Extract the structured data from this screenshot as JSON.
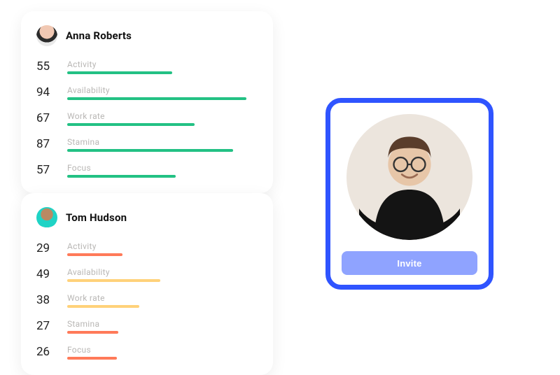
{
  "colors": {
    "accent": "#2f54ff",
    "invite_button": "#8fa3ff",
    "bar_green": "#23c184",
    "bar_yellow": "#ffd27a",
    "bar_orange": "#ff7a59"
  },
  "cards": [
    {
      "name": "Anna Roberts",
      "avatar_hint": "woman-dark-hair",
      "stats": [
        {
          "label": "Activity",
          "value": 55,
          "color": "green"
        },
        {
          "label": "Availability",
          "value": 94,
          "color": "green"
        },
        {
          "label": "Work rate",
          "value": 67,
          "color": "green"
        },
        {
          "label": "Stamina",
          "value": 87,
          "color": "green"
        },
        {
          "label": "Focus",
          "value": 57,
          "color": "green"
        }
      ]
    },
    {
      "name": "Tom Hudson",
      "avatar_hint": "man-teal-jacket",
      "stats": [
        {
          "label": "Activity",
          "value": 29,
          "color": "orange"
        },
        {
          "label": "Availability",
          "value": 49,
          "color": "yellow"
        },
        {
          "label": "Work rate",
          "value": 38,
          "color": "yellow"
        },
        {
          "label": "Stamina",
          "value": 27,
          "color": "orange"
        },
        {
          "label": "Focus",
          "value": 26,
          "color": "orange"
        }
      ]
    }
  ],
  "invite_card": {
    "avatar_hint": "man-glasses-black-shirt",
    "button_label": "Invite"
  }
}
